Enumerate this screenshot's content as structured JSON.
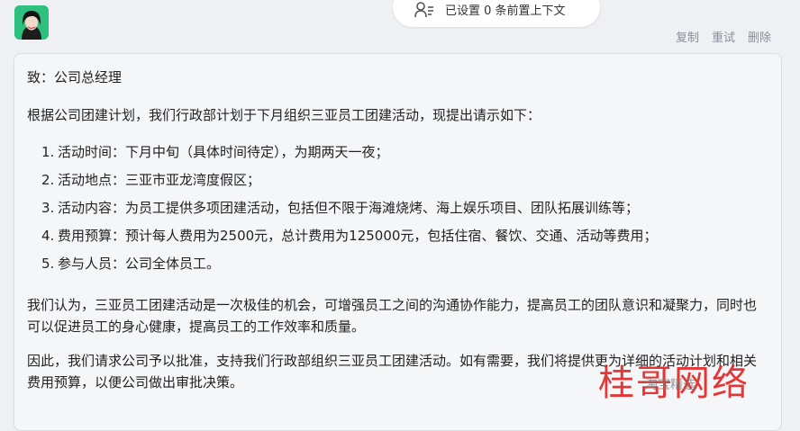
{
  "context": {
    "label": "已设置 0 条前置上下文"
  },
  "actions": {
    "copy": "复制",
    "retry": "重试",
    "delete": "删除"
  },
  "message": {
    "salutation": "致：公司总经理",
    "intro": "根据公司团建计划，我们行政部计划于下月组织三亚员工团建活动，现提出请示如下：",
    "items": [
      {
        "num": "1.",
        "text": "活动时间：下月中旬（具体时间待定），为期两天一夜；"
      },
      {
        "num": "2.",
        "text": "活动地点：三亚市亚龙湾度假区；"
      },
      {
        "num": "3.",
        "text": "活动内容：为员工提供多项团建活动，包括但不限于海滩烧烤、海上娱乐项目、团队拓展训练等；"
      },
      {
        "num": "4.",
        "text": "费用预算：预计每人费用为2500元，总计费用为125000元，包括住宿、餐饮、交通、活动等费用；"
      },
      {
        "num": "5.",
        "text": "参与人员：公司全体员工。"
      }
    ],
    "para1": "我们认为，三亚员工团建活动是一次极佳的机会，可增强员工之间的沟通协作能力，提高员工的团队意识和凝聚力，同时也可以促进员工的身心健康，提高员工的工作效率和质量。",
    "para2": "因此，我们请求公司予以批准，支持我们行政部组织三亚员工团建活动。如有需要，我们将提供更为详细的活动计划和相关费用预算，以便公司做出审批决策。"
  },
  "watermark": {
    "main": "桂哥网络",
    "sub": "淘宝精选"
  },
  "colors": {
    "avatar_bg": "#2fc07f",
    "watermark": "#e11414"
  }
}
